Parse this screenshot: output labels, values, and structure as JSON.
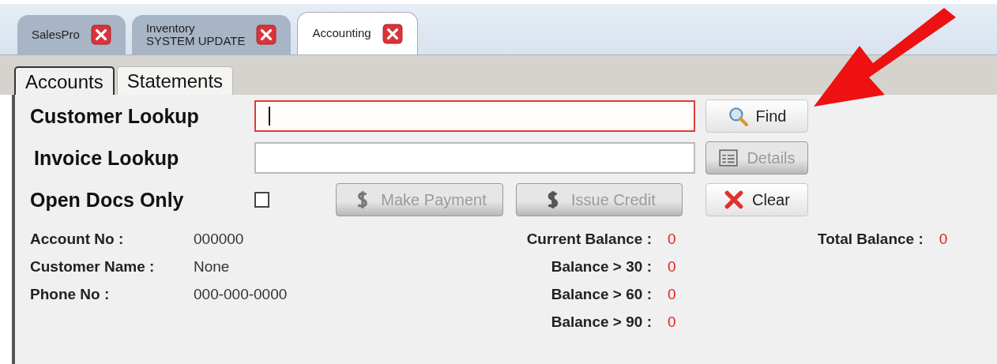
{
  "app_tabs": [
    {
      "label": "SalesPro",
      "selected": false
    },
    {
      "label": "Inventory\nSYSTEM UPDATE",
      "selected": false
    },
    {
      "label": "Accounting",
      "selected": true
    }
  ],
  "sub_tabs": [
    {
      "label": "Accounts",
      "selected": true
    },
    {
      "label": "Statements",
      "selected": false
    }
  ],
  "form": {
    "customer_lookup": {
      "label": "Customer Lookup",
      "focused": true
    },
    "invoice_lookup": {
      "label": "Invoice Lookup",
      "focused": false
    },
    "open_docs_only": {
      "label": "Open Docs Only",
      "checked": false
    },
    "buttons": {
      "find": {
        "label": "Find",
        "disabled": false
      },
      "details": {
        "label": "Details",
        "disabled": true
      },
      "make_payment": {
        "label": "Make Payment",
        "disabled": true
      },
      "issue_credit": {
        "label": "Issue Credit",
        "disabled": true
      },
      "clear": {
        "label": "Clear",
        "disabled": false
      }
    }
  },
  "account_info": [
    {
      "label": "Account No :",
      "value": "000000"
    },
    {
      "label": "Customer Name :",
      "value": "None"
    },
    {
      "label": "Phone No :",
      "value": "000-000-0000"
    }
  ],
  "balances": [
    {
      "label": "Current Balance :",
      "value": "0"
    },
    {
      "label": "Balance > 30 :",
      "value": "0"
    },
    {
      "label": "Balance > 60 :",
      "value": "0"
    },
    {
      "label": "Balance > 90 :",
      "value": "0"
    }
  ],
  "total_balance": {
    "label": "Total Balance :",
    "value": "0"
  }
}
